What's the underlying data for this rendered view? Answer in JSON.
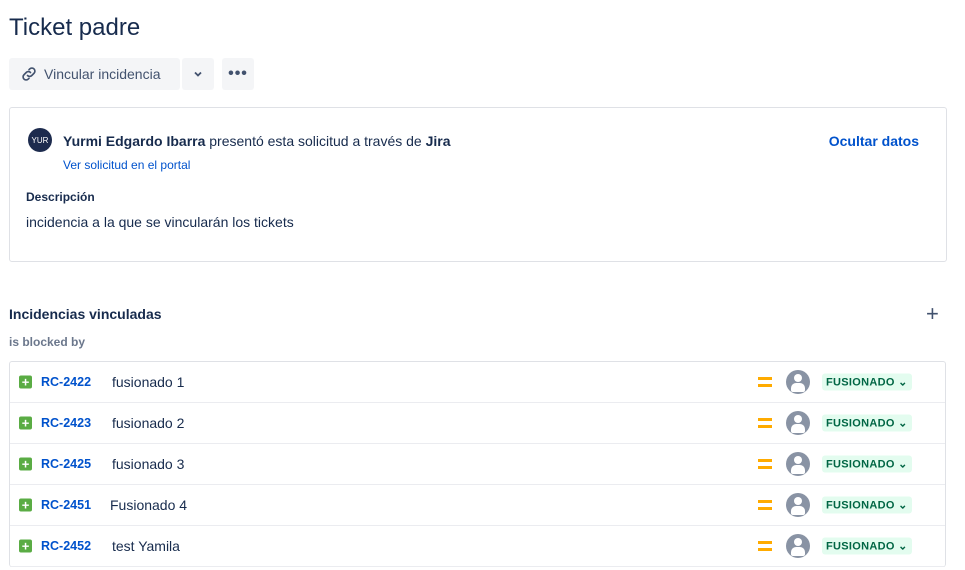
{
  "title": "Ticket padre",
  "toolbar": {
    "link_label": "Vincular incidencia"
  },
  "request": {
    "avatar": "YUR",
    "author": "Yurmi Edgardo Ibarra",
    "action": "presentó esta solicitud a través de",
    "channel": "Jira",
    "portal_link": "Ver solicitud en el portal",
    "hide_label": "Ocultar datos",
    "desc_label": "Descripción",
    "description": "incidencia a la que se vincularán los tickets"
  },
  "linked": {
    "title": "Incidencias vinculadas",
    "relation": "is blocked by",
    "items": [
      {
        "key": "RC-2422",
        "summary": "fusionado 1",
        "status": "FUSIONADO"
      },
      {
        "key": "RC-2423",
        "summary": "fusionado 2",
        "status": "FUSIONADO"
      },
      {
        "key": "RC-2425",
        "summary": "fusionado 3",
        "status": "FUSIONADO"
      },
      {
        "key": "RC-2451",
        "summary": "Fusionado 4",
        "status": "FUSIONADO"
      },
      {
        "key": "RC-2452",
        "summary": "test Yamila",
        "status": "FUSIONADO"
      }
    ]
  }
}
